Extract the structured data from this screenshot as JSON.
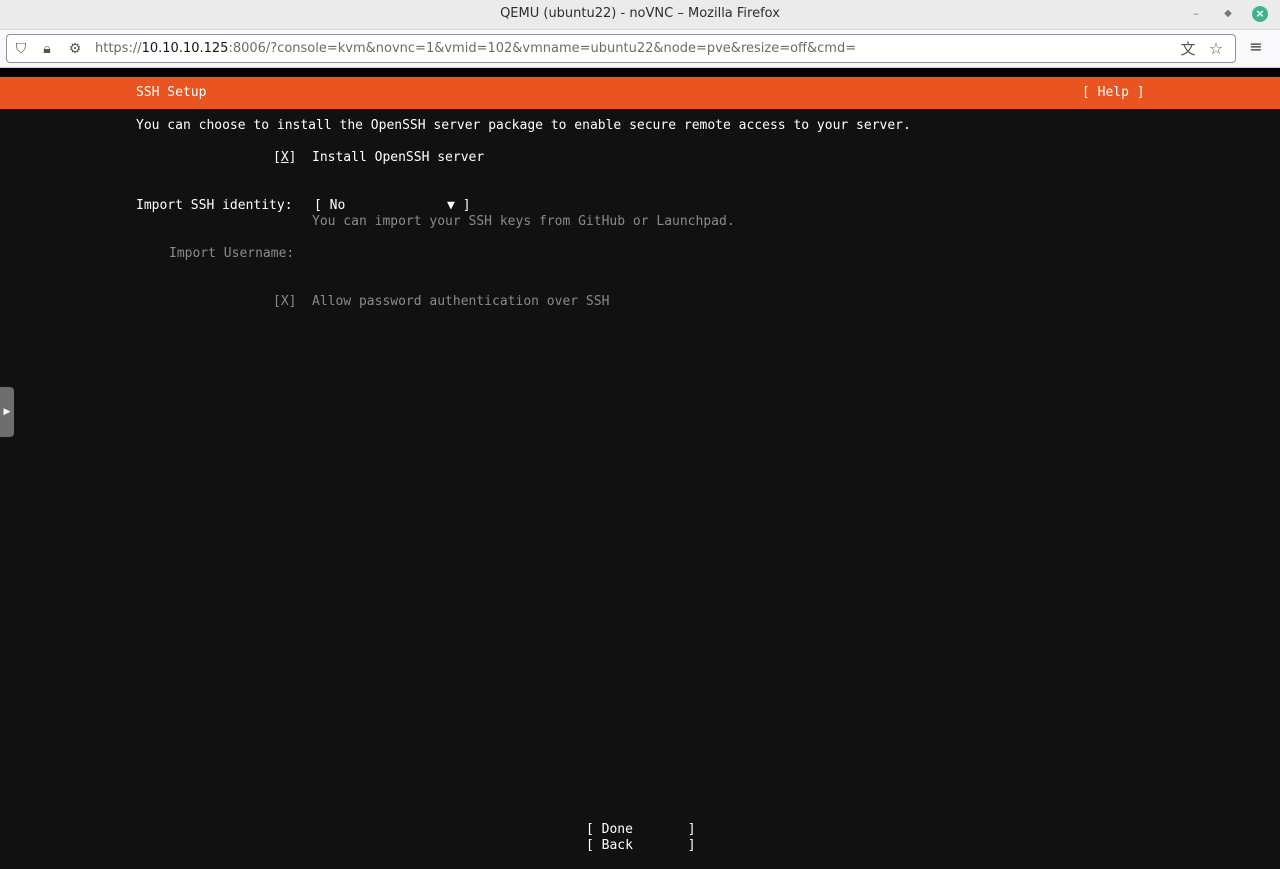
{
  "window": {
    "title": "QEMU (ubuntu22) - noVNC – Mozilla Firefox"
  },
  "navbar": {
    "url_prefix": "https://",
    "url_host": "10.10.10.125",
    "url_rest": ":8006/?console=kvm&novnc=1&vmid=102&vmname=ubuntu22&node=pve&resize=off&cmd="
  },
  "installer": {
    "header_title": "SSH Setup",
    "help_button": "[ Help ]",
    "intro": "You can choose to install the OpenSSH server package to enable secure remote access to your server.",
    "install_openssh": {
      "bracket_open": "[",
      "mark": "X",
      "bracket_close": "]",
      "label": "Install OpenSSH server"
    },
    "import_identity": {
      "label": "Import SSH identity:",
      "value": "[ No             ▼ ]",
      "hint": "You can import your SSH keys from GitHub or Launchpad."
    },
    "import_username": {
      "label": "Import Username:"
    },
    "allow_password": {
      "checkbox": "[X]",
      "label": "Allow password authentication over SSH"
    },
    "done_button": "[ Done       ]",
    "back_button": "[ Back       ]"
  },
  "colors": {
    "accent": "#e95420",
    "background": "#111111",
    "dim_text": "#8a8a8a"
  }
}
